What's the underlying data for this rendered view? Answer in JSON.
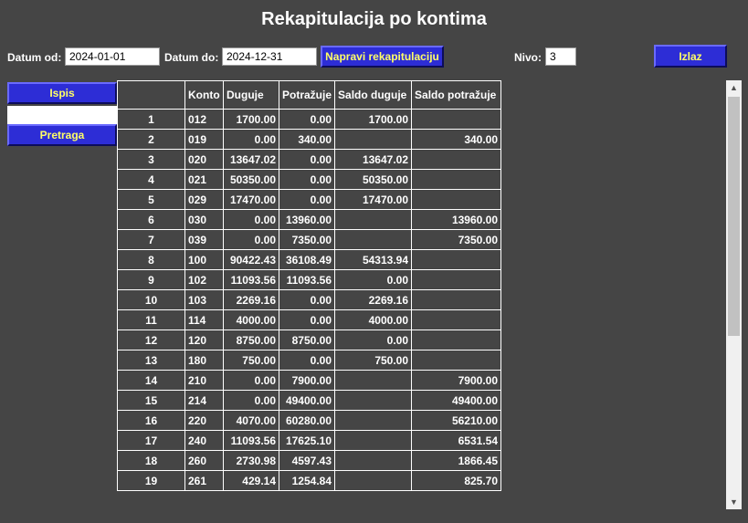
{
  "title": "Rekapitulacija po kontima",
  "filters": {
    "date_from_label": "Datum od:",
    "date_from_value": "2024-01-01",
    "date_to_label": "Datum do:",
    "date_to_value": "2024-12-31",
    "generate_label": "Napravi rekapitulaciju",
    "level_label": "Nivo:",
    "level_value": "3",
    "exit_label": "Izlaz"
  },
  "sidebar": {
    "print_label": "Ispis",
    "search_label": "Pretraga"
  },
  "table": {
    "headers": [
      "",
      "Konto",
      "Duguje",
      "Potražuje",
      "Saldo duguje",
      "Saldo potražuje"
    ],
    "rows": [
      [
        "1",
        "012",
        "1700.00",
        "0.00",
        "1700.00",
        ""
      ],
      [
        "2",
        "019",
        "0.00",
        "340.00",
        "",
        "340.00"
      ],
      [
        "3",
        "020",
        "13647.02",
        "0.00",
        "13647.02",
        ""
      ],
      [
        "4",
        "021",
        "50350.00",
        "0.00",
        "50350.00",
        ""
      ],
      [
        "5",
        "029",
        "17470.00",
        "0.00",
        "17470.00",
        ""
      ],
      [
        "6",
        "030",
        "0.00",
        "13960.00",
        "",
        "13960.00"
      ],
      [
        "7",
        "039",
        "0.00",
        "7350.00",
        "",
        "7350.00"
      ],
      [
        "8",
        "100",
        "90422.43",
        "36108.49",
        "54313.94",
        ""
      ],
      [
        "9",
        "102",
        "11093.56",
        "11093.56",
        "0.00",
        ""
      ],
      [
        "10",
        "103",
        "2269.16",
        "0.00",
        "2269.16",
        ""
      ],
      [
        "11",
        "114",
        "4000.00",
        "0.00",
        "4000.00",
        ""
      ],
      [
        "12",
        "120",
        "8750.00",
        "8750.00",
        "0.00",
        ""
      ],
      [
        "13",
        "180",
        "750.00",
        "0.00",
        "750.00",
        ""
      ],
      [
        "14",
        "210",
        "0.00",
        "7900.00",
        "",
        "7900.00"
      ],
      [
        "15",
        "214",
        "0.00",
        "49400.00",
        "",
        "49400.00"
      ],
      [
        "16",
        "220",
        "4070.00",
        "60280.00",
        "",
        "56210.00"
      ],
      [
        "17",
        "240",
        "11093.56",
        "17625.10",
        "",
        "6531.54"
      ],
      [
        "18",
        "260",
        "2730.98",
        "4597.43",
        "",
        "1866.45"
      ],
      [
        "19",
        "261",
        "429.14",
        "1254.84",
        "",
        "825.70"
      ]
    ]
  },
  "scrollbar": {
    "up_icon": "triangle-up",
    "down_icon": "triangle-down"
  }
}
